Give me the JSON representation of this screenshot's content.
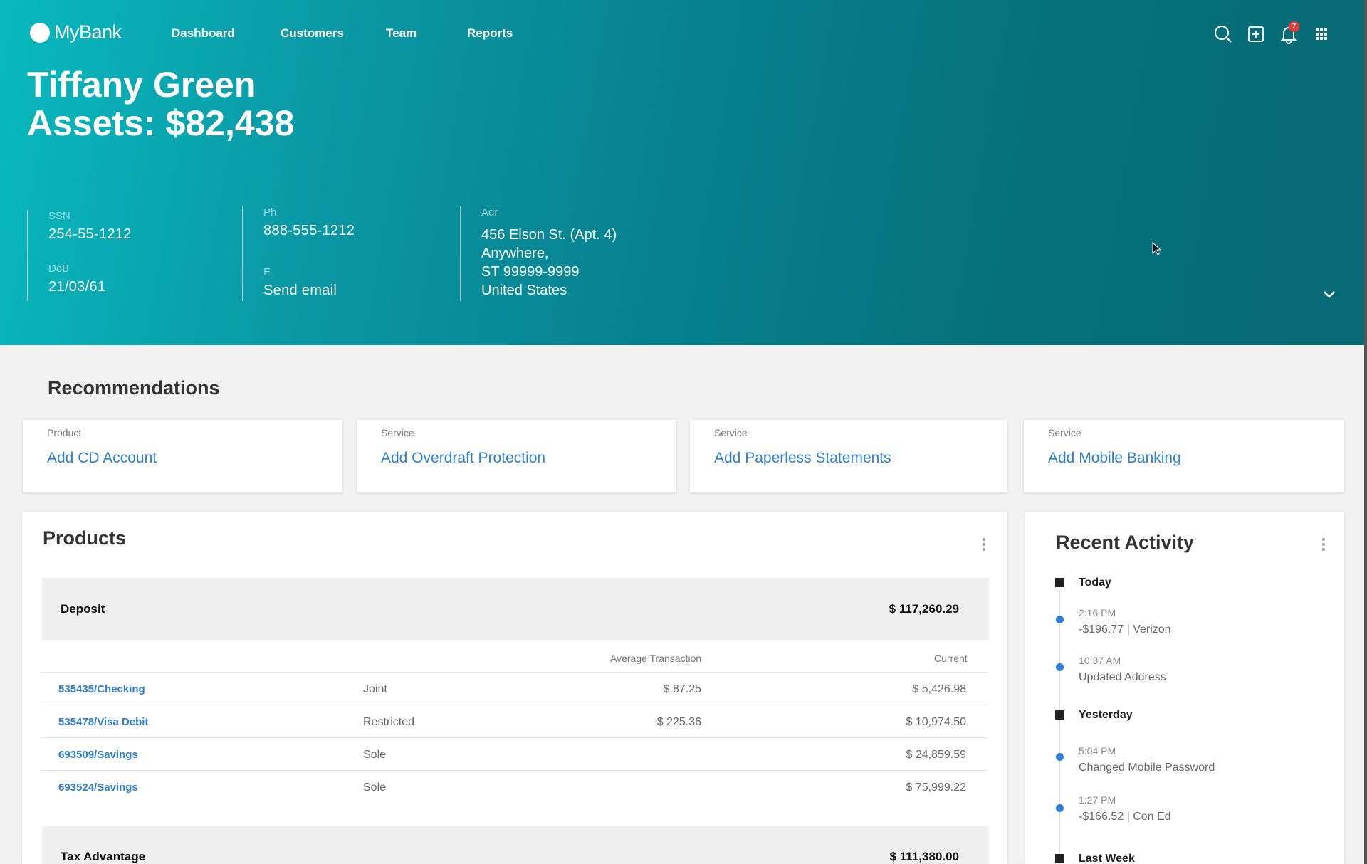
{
  "brand": {
    "name": "MyBank"
  },
  "nav": [
    {
      "label": "Dashboard"
    },
    {
      "label": "Customers"
    },
    {
      "label": "Team"
    },
    {
      "label": "Reports"
    }
  ],
  "header_icons": [
    "search-icon",
    "add-icon",
    "bell-icon",
    "apps-grid-icon"
  ],
  "notifications": {
    "count": "7"
  },
  "customer": {
    "name": "Tiffany Green",
    "assets": "Assets: $82,438",
    "ssn_label": "SSN",
    "ssn": "254-55-1212",
    "dob_label": "DoB",
    "dob": "21/03/61",
    "phone_label": "Ph",
    "phone": "888-555-1212",
    "email_label": "E",
    "email_action": "Send email",
    "address_label": "Adr",
    "address": [
      "456 Elson St. (Apt. 4)",
      "Anywhere,",
      "ST 99999-9999",
      "United States"
    ]
  },
  "recommendations": {
    "title": "Recommendations",
    "cards": [
      {
        "type": "Product",
        "title": "Add CD Account"
      },
      {
        "type": "Service",
        "title": "Add Overdraft Protection"
      },
      {
        "type": "Service",
        "title": "Add Paperless Statements"
      },
      {
        "type": "Service",
        "title": "Add Mobile Banking"
      }
    ]
  },
  "products": {
    "title": "Products",
    "groups": [
      {
        "name": "Deposit",
        "total": "$ 117,260.29"
      },
      {
        "name": "Tax Advantage",
        "total": "$ 111,380.00"
      }
    ],
    "columns": {
      "avg": "Average Transaction",
      "current": "Current"
    },
    "rows": [
      {
        "account": "535435/Checking",
        "type": "Joint",
        "avg": "$ 87.25",
        "current": "$ 5,426.98"
      },
      {
        "account": "535478/Visa Debit",
        "type": "Restricted",
        "avg": "$ 225.36",
        "current": "$ 10,974.50"
      },
      {
        "account": "693509/Savings",
        "type": "Sole",
        "avg": "",
        "current": "$ 24,859.59"
      },
      {
        "account": "693524/Savings",
        "type": "Sole",
        "avg": "",
        "current": "$ 75,999.22"
      }
    ]
  },
  "activity": {
    "title": "Recent Activity",
    "days": [
      "Today",
      "Yesterday",
      "Last Week"
    ],
    "items": [
      {
        "time": "2:16 PM",
        "desc": "-$196.77  |  Verizon"
      },
      {
        "time": "10:37 AM",
        "desc": "Updated Address"
      },
      {
        "time": "5:04 PM",
        "desc": "Changed Mobile Password"
      },
      {
        "time": "1:27 PM",
        "desc": "-$166.52  |  Con Ed"
      }
    ]
  },
  "colors": {
    "accent": "#2f7fd6",
    "hero_start": "#08b9be",
    "hero_end": "#076a75",
    "badge": "#e53935"
  }
}
